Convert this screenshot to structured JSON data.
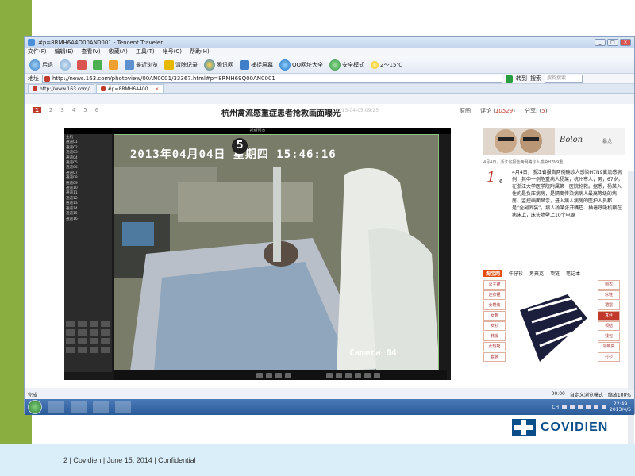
{
  "window": {
    "title": "#p=8RMH6A4O00AN0001 - Tencent Traveler",
    "controls": [
      "_",
      "□",
      "×"
    ]
  },
  "menu": [
    "文件(F)",
    "编辑(E)",
    "查看(V)",
    "收藏(A)",
    "工具(T)",
    "帐号(C)",
    "帮助(H)"
  ],
  "toolbar": {
    "back": "后退",
    "recent": "最近浏览",
    "clear": "清除记录",
    "tencent": "腾讯网",
    "screenshot": "捕捉屏幕",
    "qq_sites": "QQ网址大全",
    "safe": "安全模式",
    "weather": "2～15℃"
  },
  "address": {
    "label": "地址",
    "url": "http://news.163.com/photoview/00AN0001/33367.html#p=8RMH69Q00AN0001",
    "go": "转到",
    "search_label": "搜索",
    "search_placeholder": "搜狗搜索"
  },
  "tabs": [
    {
      "label": "http://www.163.com/"
    },
    {
      "label": "#p=8RMH6A400..."
    }
  ],
  "page": {
    "pager": [
      "1",
      "2",
      "3",
      "4",
      "5",
      "6"
    ],
    "headline": "杭州禽流感重症患者抢救画面曝光",
    "headline_date": "2013-04-05 09:25",
    "view_label": "原图",
    "comment_label": "评论",
    "comment_count": "10529",
    "share_label": "分享",
    "share_count": "5"
  },
  "photo": {
    "header": "视频预览",
    "timestamp": "2013年04月04日 星期四 15:46:16",
    "channel": "5",
    "camera": "Camera 04",
    "channels": [
      "主机",
      "通道01",
      "通道02",
      "通道03",
      "通道04",
      "通道05",
      "通道06",
      "通道07",
      "通道08",
      "通道09",
      "通道10",
      "通道11",
      "通道12",
      "通道13",
      "通道14",
      "通道15",
      "通道16"
    ]
  },
  "sidebar": {
    "ad_brand": "Bolon",
    "ad_brand_sub": "暴龙",
    "caption": "4月4日，浙江省报告两例确诊人感染H7N9重...",
    "story_index": "1",
    "story_total": "6",
    "story": "4月4日，浙江省报告两例确诊人感染H7N9禽流感病例，其中一例危重病人杨某，杭州市人，男，67岁，在浙江大学医学院附属第一医院抢救。据悉，杨某入住的是负压病房，是隔离传染病病人最高等级的病房。监控画面显示，进入病人病房的医护人员都是“全副武装”，病人杨某张开嘴巴、插着呼吸机躺在病床上，床头墙壁上10个电源",
    "shop_logo": "淘宝网",
    "shop_tabs": [
      "牛仔衫",
      "男夹克",
      "项链",
      "笔记本"
    ],
    "shop_left": [
      "公主裙",
      "连衣裙",
      "女鞋装",
      "女靴",
      "女衫",
      "韩版",
      "女短靴",
      "套装"
    ],
    "shop_right": [
      "帽衣",
      "冰鞋",
      "裙摆",
      "真丝",
      "领结",
      "钱包",
      "领带夹",
      "衬衫"
    ],
    "shop_hot": "真丝"
  },
  "status": {
    "left": "完成",
    "time": "00:00",
    "mode": "自定义浏览模式",
    "zoom": "缩放100%"
  },
  "taskbar": {
    "clock_time": "22:49",
    "clock_date": "2013/4/5",
    "input": "CH"
  },
  "slide_footer": {
    "text": "2   |   Covidien   |   June 15, 2014   |   Confidential",
    "logo": "COVIDIEN"
  }
}
